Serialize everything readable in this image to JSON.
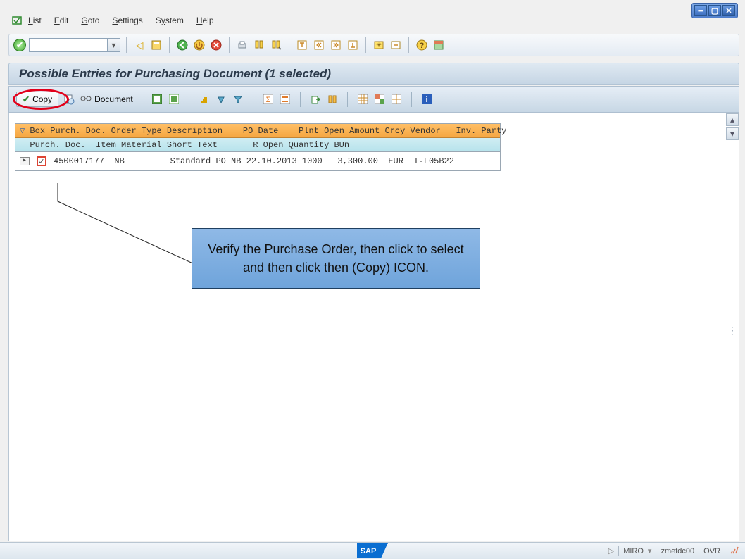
{
  "menu": {
    "list": "List",
    "edit": "Edit",
    "goto": "Goto",
    "settings": "Settings",
    "system": "System",
    "help": "Help"
  },
  "title": "Possible Entries for Purchasing Document (1 selected)",
  "apptoolbar": {
    "copy_label": "Copy",
    "document_label": "Document"
  },
  "table": {
    "header1": " Box Purch. Doc. Order Type Description    PO Date    Plnt Open Amount Crcy Vendor   Inv. Party",
    "header2": "  Purch. Doc.  Item Material Short Text       R Open Quantity BUn",
    "row": {
      "purch_doc": "4500017177",
      "order_type": "NB",
      "description": "Standard PO NB",
      "po_date": "22.10.2013",
      "plant": "1000",
      "open_amount": "3,300.00",
      "crcy": "EUR",
      "vendor": "T-L05B22"
    }
  },
  "callout": "Verify the Purchase Order, then click to select and then click then (Copy) ICON.",
  "status": {
    "tcode": "MIRO",
    "system": "zmetdc00",
    "ovr": "OVR"
  }
}
